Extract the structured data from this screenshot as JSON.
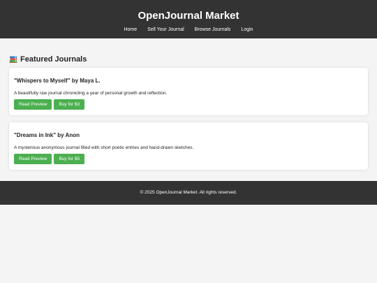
{
  "header": {
    "title": "OpenJournal Market",
    "nav": [
      "Home",
      "Sell Your Journal",
      "Browse Journals",
      "Login"
    ]
  },
  "featured": {
    "heading": "Featured Journals",
    "icon": "books-icon",
    "journals": [
      {
        "title": "\"Whispers to Myself\" by Maya L.",
        "description": "A beautifully raw journal chronicling a year of personal growth and reflection.",
        "preview_label": "Read Preview",
        "buy_label": "Buy for $3"
      },
      {
        "title": "\"Dreams in Ink\" by Anon",
        "description": "A mysterious anonymous journal filled with short poetic entries and hand-drawn sketches.",
        "preview_label": "Read Preview",
        "buy_label": "Buy for $5"
      }
    ]
  },
  "footer": {
    "text": "© 2025 OpenJournal Market. All rights reserved."
  },
  "colors": {
    "header_bg": "#333333",
    "page_bg": "#f4f4f4",
    "button_green": "#4caf50"
  }
}
